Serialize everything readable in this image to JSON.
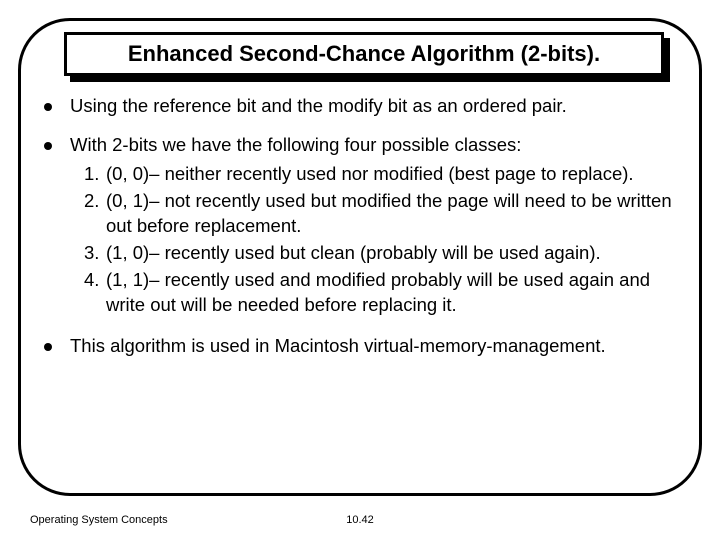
{
  "title": "Enhanced Second-Chance Algorithm (2-bits).",
  "bullets": {
    "b1": "Using the reference bit and the modify bit as an ordered pair.",
    "b2_intro": "With 2-bits we have the following four possible classes:",
    "b2_items": {
      "i1_num": "1.",
      "i1": "(0, 0)– neither recently used nor modified (best page to replace).",
      "i2_num": "2.",
      "i2": "(0, 1)– not recently used but modified the page will need to be written out before replacement.",
      "i3_num": "3.",
      "i3": "(1, 0)– recently used but clean (probably will be used again).",
      "i4_num": "4.",
      "i4": "(1, 1)– recently used and modified probably will be used again and write out will be needed before replacing it."
    },
    "b3": "This algorithm is used in Macintosh virtual-memory-management."
  },
  "footer": {
    "left": "Operating System Concepts",
    "center": "10.42"
  }
}
